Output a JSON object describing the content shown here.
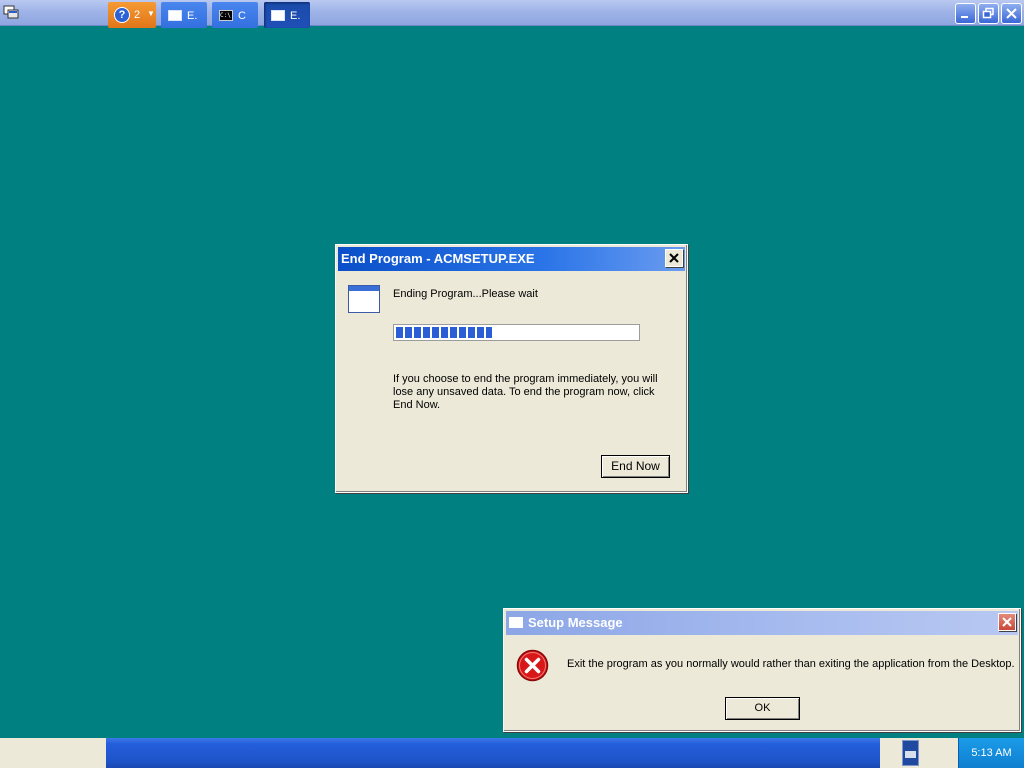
{
  "end_program_dialog": {
    "title": "End Program - ACMSETUP.EXE",
    "status_text": "Ending Program...Please wait",
    "progress_fraction": 0.4,
    "info_text": "If you choose to end the program immediately, you will lose any unsaved data. To end the program now, click End Now.",
    "end_now_label": "End Now"
  },
  "setup_message_dialog": {
    "title": "Setup Message",
    "message": "Exit the program as you normally would rather than exiting the application from the Desktop.",
    "ok_label": "OK"
  },
  "taskbar": {
    "help_count": "2",
    "tasks": [
      {
        "label": "E.",
        "icon": "window-icon",
        "active": false
      },
      {
        "label": "C",
        "icon": "command-prompt-icon",
        "active": false
      },
      {
        "label": "E.",
        "icon": "window-icon",
        "active": true
      }
    ],
    "clock": "5:13 AM"
  },
  "colors": {
    "desktop": "#008080",
    "titlebar_active": "#0a4fc9",
    "titlebar_inactive": "#8ca6e6",
    "progress": "#2a5ed6"
  }
}
